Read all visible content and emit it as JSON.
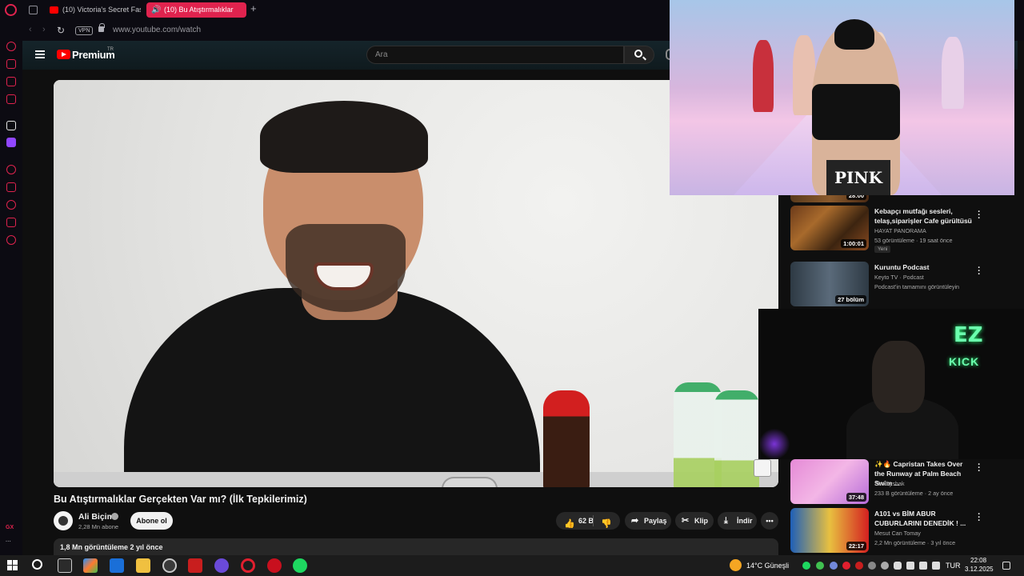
{
  "browser": {
    "tabs": [
      {
        "label": "(10) Victoria's Secret Fash",
        "active": false
      },
      {
        "label": "(10) Bu Atıştırmalıklar",
        "active": true
      }
    ],
    "new_tab_symbol": "+",
    "vpn_label": "VPN",
    "url": "www.youtube.com/watch",
    "sidebar_bottom_label": "GX"
  },
  "youtube": {
    "logo_text": "Premium",
    "logo_region": "TR",
    "search_placeholder": "Ara",
    "video": {
      "title": "Bu Atıştırmalıklar Gerçekten Var mı? (İlk Tepkilerimiz)",
      "channel": "Ali Biçim",
      "subscribers": "2,28 Mn abone",
      "subscribe_label": "Abone ol",
      "likes": "62 B",
      "share_label": "Paylaş",
      "clip_label": "Klip",
      "download_label": "İndir",
      "more_symbol": "•••",
      "stats": "1,8 Mn görüntüleme  2 yıl önce"
    },
    "recommendations": [
      {
        "title": "",
        "meta1": "",
        "meta2": "",
        "duration": "28:00"
      },
      {
        "title": "Kebapçı mutfağı sesleri, telaş,siparişler Cafe gürültüsü",
        "meta1": "HAYAT PANORAMA",
        "meta2": "53 görüntüleme · 19 saat önce",
        "duration": "1:00:01",
        "badge": "Yeni"
      },
      {
        "title": "Kuruntu Podcast",
        "meta1": "Keyto TV · Podcast",
        "meta2": "Podcast'in tamamını görüntüleyin",
        "duration": "27 bölüm"
      },
      {
        "title": "✨🔥 Capristan Takes Over the Runway at Palm Beach Swim ...",
        "meta1": "Shotbyshak",
        "meta2": "233 B görüntüleme · 2 ay önce",
        "duration": "37:48"
      },
      {
        "title": "A101 vs BİM ABUR CUBURLARINI DENEDİK ! ...",
        "meta1": "Mesut Can Tomay",
        "meta2": "2,2 Mn görüntüleme · 3 yıl önce",
        "duration": "22:17"
      }
    ]
  },
  "overlays": {
    "pip_top_text": "PINK",
    "pip_bottom_logo_top": "EZ",
    "pip_bottom_logo_bottom": "KICK"
  },
  "taskbar": {
    "weather": "14°C  Güneşli",
    "language": "TUR",
    "time": "22:08",
    "date": "3.12.2025"
  }
}
